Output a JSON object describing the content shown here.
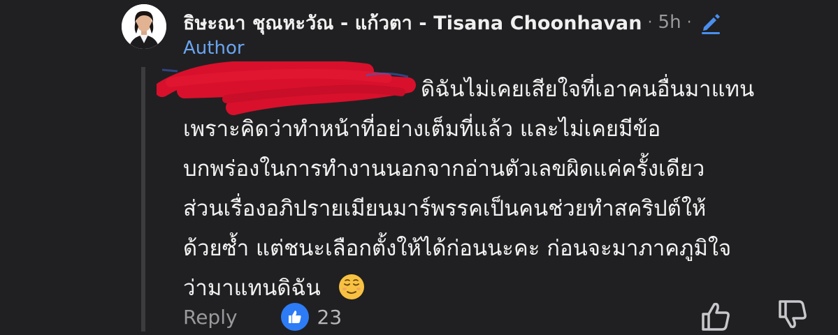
{
  "comment": {
    "author": "ธิษะณา ชุณหะวัณ - แก้วตา - Tisana Choonhavan",
    "separator": "·",
    "time": "5h",
    "badge": "Author",
    "lines": [
      "ดิฉันไม่เคยเสียใจที่เอาคนอื่นมาแทน",
      "เพราะคิดว่าทำหน้าที่อย่างเต็มที่แล้ว และไม่เคยมีข้อ",
      "บกพร่องในการทำงานนอกจากอ่านตัวเลขผิดแค่ครั้งเดียว",
      "ส่วนเรื่องอภิปรายเมียนมาร์พรรคเป็นคนช่วยทำสคริปต์ให้",
      "ด้วยซ้ำ แต่ชนะเลือกตั้งให้ได้ก่อนนะคะ ก่อนจะมาภาคภูมิใจ",
      "ว่ามาแทนดิฉัน"
    ],
    "emoji": "relieved-face-emoji"
  },
  "footer": {
    "reply_label": "Reply",
    "like_count": "23"
  },
  "colors": {
    "background": "#202022",
    "author_badge": "#6aa5f0",
    "like_blue": "#2d7cf6",
    "redaction": "#d8102c"
  },
  "icons": [
    "edit-icon",
    "like-icon",
    "thumb-up-icon",
    "thumb-down-icon"
  ]
}
